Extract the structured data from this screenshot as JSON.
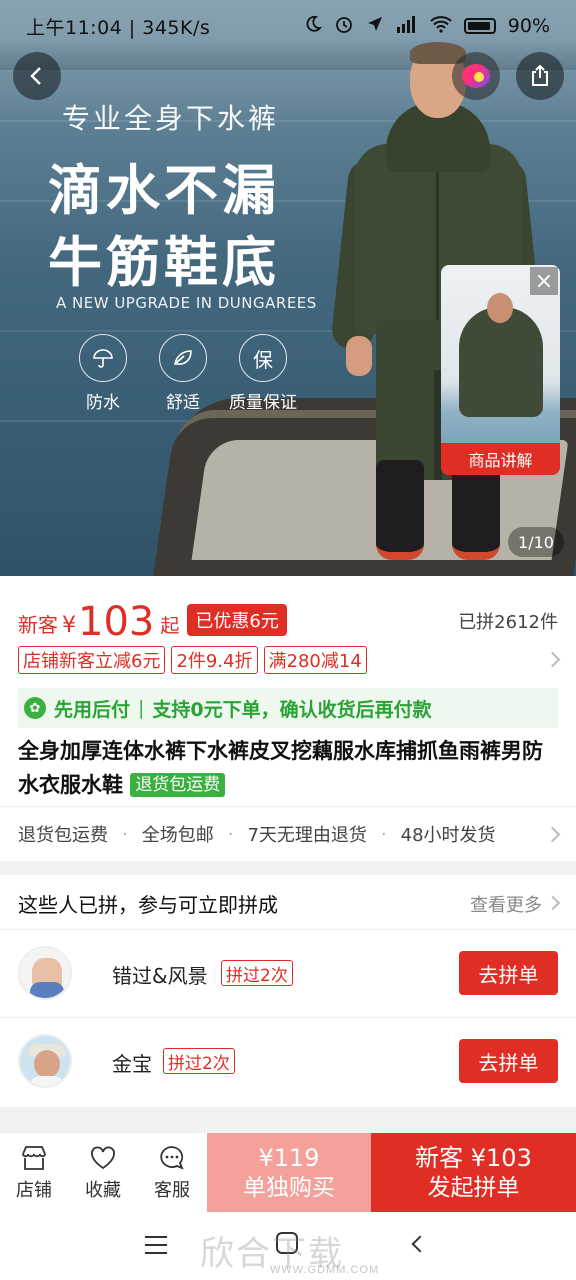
{
  "status_bar": {
    "time_speed": "上午11:04 | 345K/s",
    "battery": "90%"
  },
  "hero": {
    "subtitle": "专业全身下水裤",
    "headline1": "滴水不漏",
    "headline2": "牛筋鞋底",
    "english": "A NEW UPGRADE IN DUNGAREES",
    "features": [
      {
        "icon": "umbrella-icon",
        "label": "防水"
      },
      {
        "icon": "leaf-icon",
        "label": "舒适"
      },
      {
        "icon_text": "保",
        "label": "质量保证"
      }
    ],
    "video_label": "商品讲解",
    "pager": "1/10"
  },
  "price": {
    "new_customer": "新客",
    "currency": "¥",
    "amount": "103",
    "suffix": "起",
    "discount_badge": "已优惠6元",
    "sold": "已拼2612件"
  },
  "promo_tags": [
    "店铺新客立减6元",
    "2件9.4折",
    "满280减14"
  ],
  "pay_later": {
    "title": "先用后付",
    "desc": "支持0元下单，确认收货后再付款"
  },
  "product": {
    "title": "全身加厚连体水裤下水裤皮叉挖藕服水库捕抓鱼雨裤男防水衣服水鞋",
    "badge": "退货包运费"
  },
  "services": [
    "退货包运费",
    "全场包邮",
    "7天无理由退货",
    "48小时发货"
  ],
  "group": {
    "heading": "这些人已拼，参与可立即拼成",
    "more": "查看更多",
    "users": [
      {
        "name": "错过&风景",
        "tag": "拼过2次",
        "button": "去拼单"
      },
      {
        "name": "金宝",
        "tag": "拼过2次",
        "button": "去拼单"
      }
    ]
  },
  "bottom_bar": {
    "store": "店铺",
    "favorite": "收藏",
    "service": "客服",
    "alone_price": "¥119",
    "alone_label": "单独购买",
    "group_price": "新客 ¥103",
    "group_label": "发起拼单"
  },
  "watermark": {
    "main": "欣合下载",
    "url": "WWW.GDMM.COM"
  },
  "colors": {
    "accent_red": "#e02e24",
    "alone_button": "#f4a19b",
    "pay_later_green": "#3ab041"
  }
}
